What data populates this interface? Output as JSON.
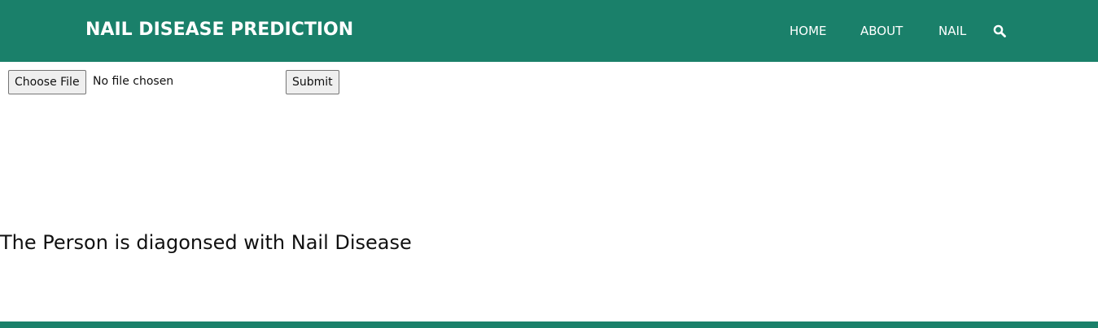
{
  "header": {
    "brand": "NAIL DISEASE PREDICTION",
    "nav": [
      "HOME",
      "ABOUT",
      "NAIL"
    ],
    "search_icon": "search-icon",
    "color": "#1a806a"
  },
  "form": {
    "choose_file_label": "Choose File",
    "file_status": "No file chosen",
    "submit_label": "Submit"
  },
  "result": {
    "text": "The Person is diagonsed with Nail Disease"
  }
}
